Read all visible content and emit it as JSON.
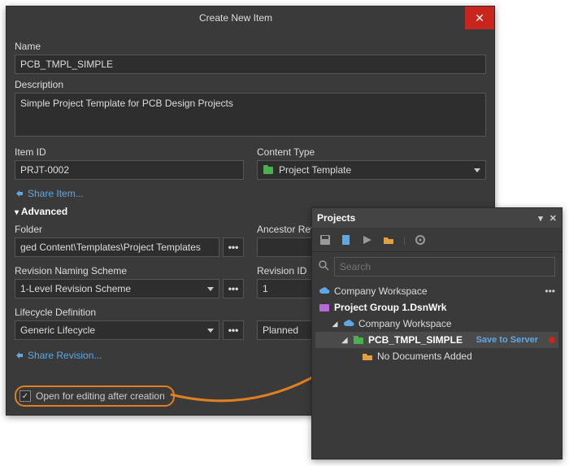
{
  "dialog": {
    "title": "Create New Item",
    "close": "✕",
    "name_label": "Name",
    "name_value": "PCB_TMPL_SIMPLE",
    "desc_label": "Description",
    "desc_value": "Simple Project Template for PCB Design Projects",
    "itemid_label": "Item ID",
    "itemid_value": "PRJT-0002",
    "contenttype_label": "Content Type",
    "contenttype_value": "Project Template",
    "share_item": "Share Item...",
    "advanced": "Advanced",
    "folder_label": "Folder",
    "folder_value": "ged Content\\Templates\\Project Templates",
    "ancestor_label": "Ancestor Revision",
    "rev_scheme_label": "Revision Naming Scheme",
    "rev_scheme_value": "1-Level Revision Scheme",
    "rev_id_label": "Revision ID",
    "rev_id_value": "1",
    "lifecycle_label": "Lifecycle Definition",
    "lifecycle_value": "Generic Lifecycle",
    "lifecycle_state": "Planned",
    "share_revision": "Share Revision...",
    "open_edit": "Open for editing after creation",
    "dots": "•••"
  },
  "panel": {
    "title": "Projects",
    "search_placeholder": "Search",
    "tree": {
      "workspace_top": "Company Workspace",
      "group": "Project Group 1.DsnWrk",
      "workspace_inner": "Company Workspace",
      "item": "PCB_TMPL_SIMPLE",
      "save": "Save to Server",
      "nodocs": "No Documents Added",
      "more": "•••"
    }
  }
}
